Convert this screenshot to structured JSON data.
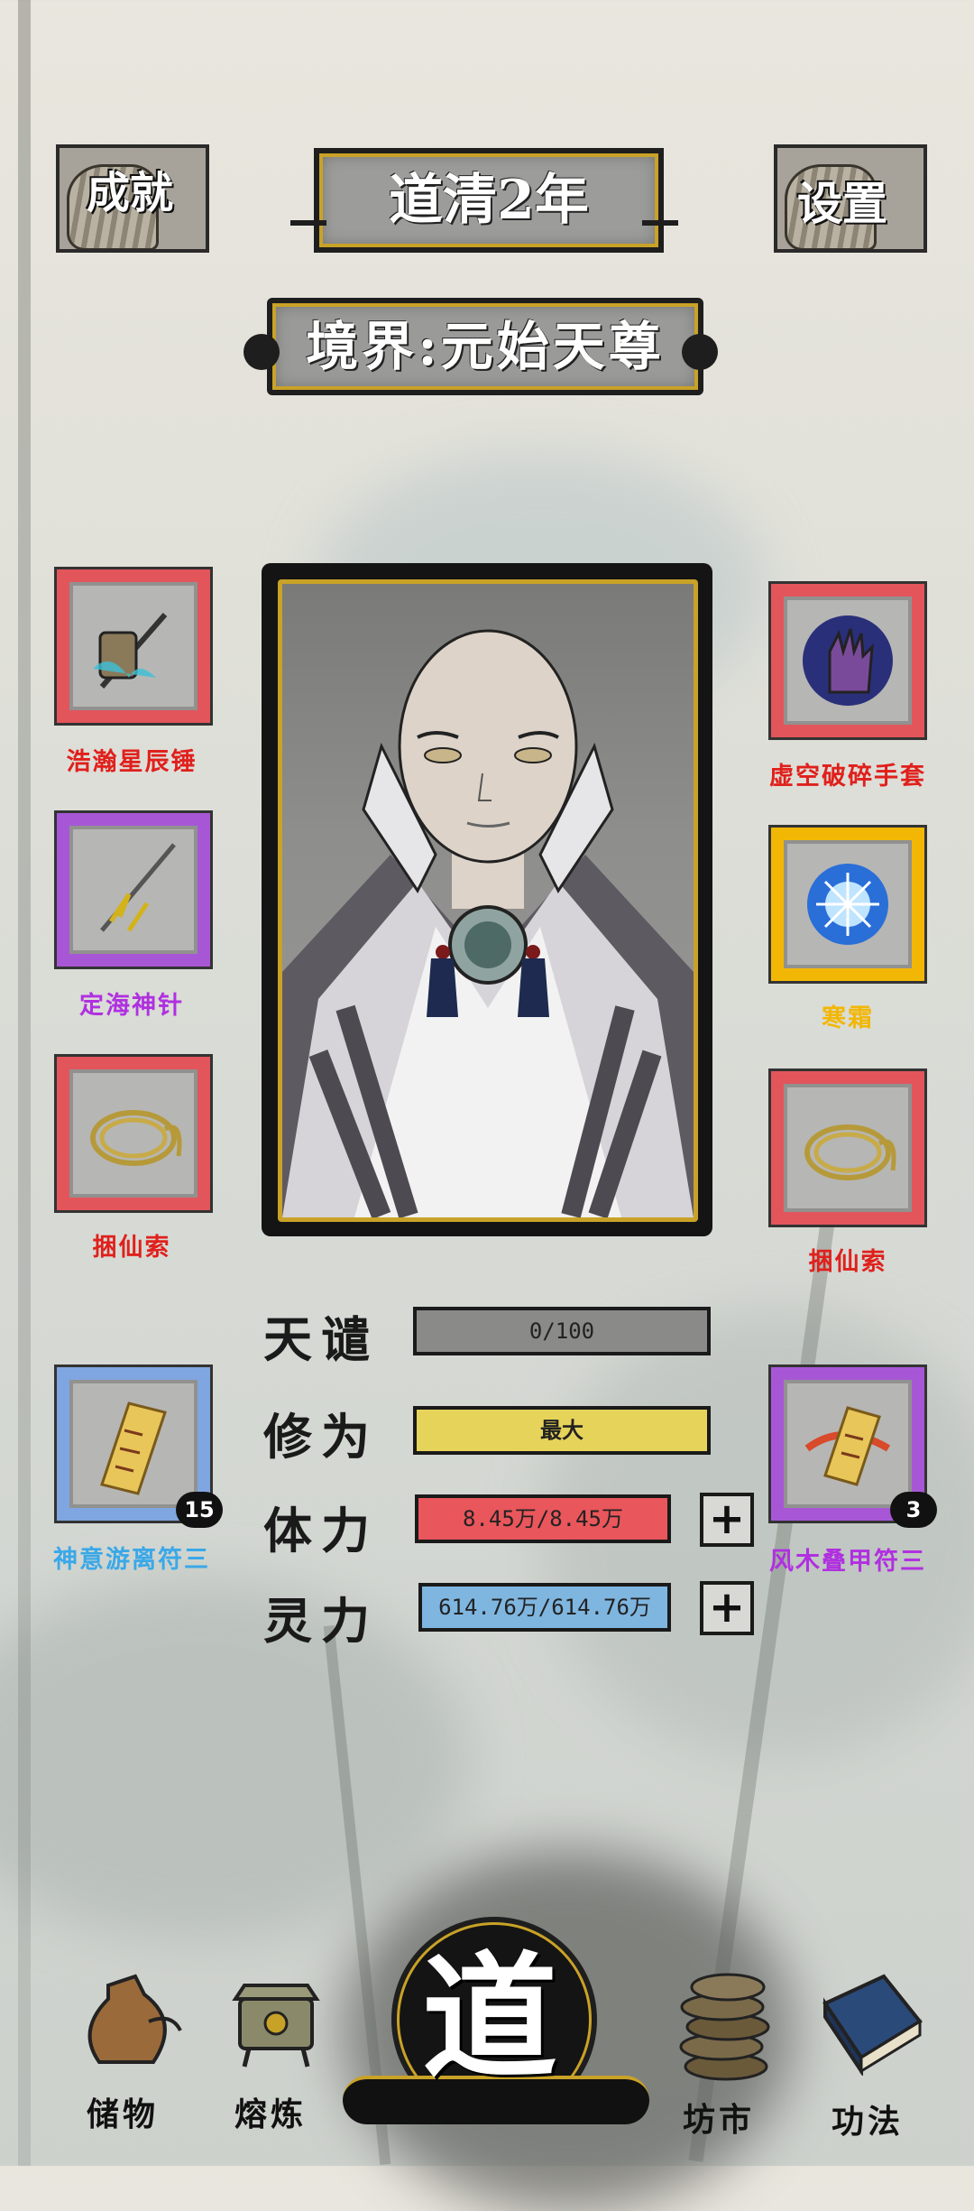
{
  "header": {
    "year": "道清2年",
    "realm": "境界:元始天尊",
    "achievements_label": "成就",
    "settings_label": "设置"
  },
  "equipment": {
    "left": [
      {
        "name": "浩瀚星辰锤",
        "color": "#e0201c",
        "icon": "hammer-icon"
      },
      {
        "name": "定海神针",
        "color": "#b030e0",
        "icon": "trident-icon"
      },
      {
        "name": "捆仙索",
        "color": "#e0201c",
        "icon": "rope-icon"
      }
    ],
    "right": [
      {
        "name": "虚空破碎手套",
        "color": "#e0201c",
        "icon": "gauntlet-icon"
      },
      {
        "name": "寒霜",
        "color": "#f2b705",
        "icon": "frost-orb-icon"
      },
      {
        "name": "捆仙索",
        "color": "#e0201c",
        "icon": "rope-icon"
      }
    ]
  },
  "talismans": {
    "left": {
      "name": "神意游离符三",
      "count": "15",
      "color": "#3aa8e8",
      "icon": "talisman-scroll-icon"
    },
    "right": {
      "name": "风木叠甲符三",
      "count": "3",
      "color": "#b030e0",
      "icon": "talisman-scroll-icon"
    }
  },
  "stats": {
    "tianqian": {
      "label": "天谴",
      "value": "0/100",
      "fill": 0,
      "color": "#8a8a88"
    },
    "xiuwei": {
      "label": "修为",
      "value": "最大",
      "fill": 1,
      "color": "#e6d35a"
    },
    "tili": {
      "label": "体力",
      "value": "8.45万/8.45万",
      "fill": 1,
      "color": "#e9565b"
    },
    "lingli": {
      "label": "灵力",
      "value": "614.76万/614.76万",
      "fill": 1,
      "color": "#7fb6e0"
    }
  },
  "nav": {
    "storage": "储物",
    "refine": "熔炼",
    "center": "道",
    "market": "坊市",
    "skills": "功法"
  }
}
